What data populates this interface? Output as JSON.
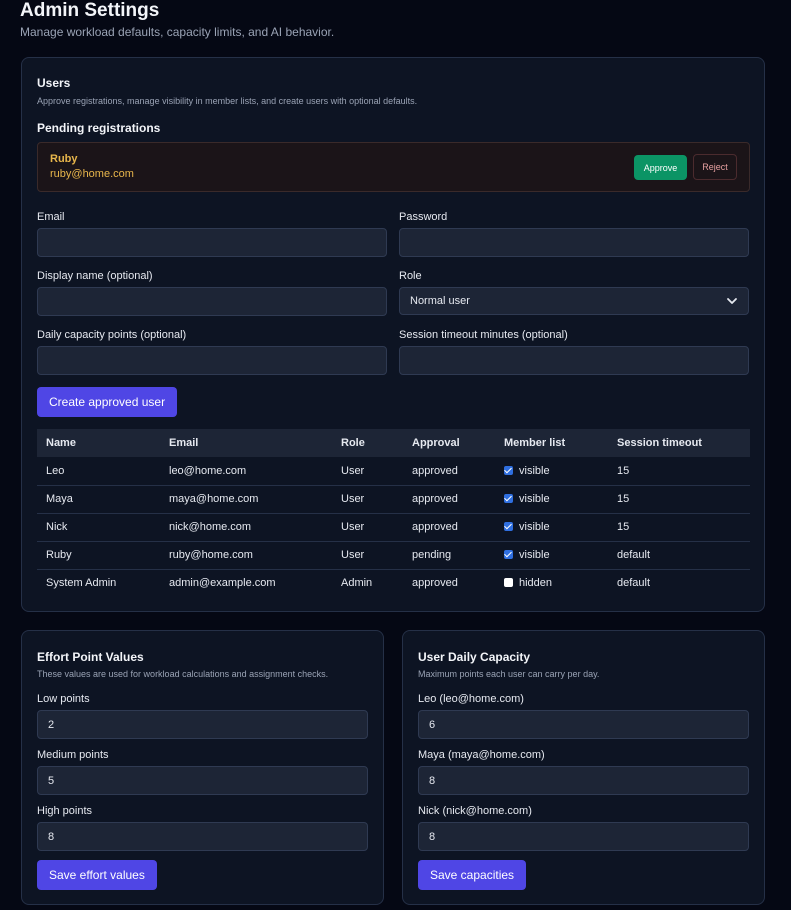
{
  "header": {
    "title": "Admin Settings",
    "subtitle": "Manage workload defaults, capacity limits, and AI behavior."
  },
  "users_card": {
    "title": "Users",
    "description": "Approve registrations, manage visibility in member lists, and create users with optional defaults.",
    "pending_title": "Pending registrations",
    "pending": {
      "name": "Ruby",
      "email": "ruby@home.com",
      "approve_label": "Approve",
      "reject_label": "Reject"
    },
    "form": {
      "email_label": "Email",
      "email_value": "",
      "password_label": "Password",
      "password_value": "",
      "display_name_label": "Display name (optional)",
      "display_name_value": "",
      "role_label": "Role",
      "role_value": "Normal user",
      "daily_capacity_label": "Daily capacity points (optional)",
      "daily_capacity_value": "",
      "session_timeout_label": "Session timeout minutes (optional)",
      "session_timeout_value": "",
      "create_button": "Create approved user"
    },
    "table": {
      "headers": [
        "Name",
        "Email",
        "Role",
        "Approval",
        "Member list",
        "Session timeout"
      ],
      "rows": [
        {
          "name": "Leo",
          "email": "leo@home.com",
          "role": "User",
          "approval": "approved",
          "visible": true,
          "member_list": "visible",
          "timeout": "15"
        },
        {
          "name": "Maya",
          "email": "maya@home.com",
          "role": "User",
          "approval": "approved",
          "visible": true,
          "member_list": "visible",
          "timeout": "15"
        },
        {
          "name": "Nick",
          "email": "nick@home.com",
          "role": "User",
          "approval": "approved",
          "visible": true,
          "member_list": "visible",
          "timeout": "15"
        },
        {
          "name": "Ruby",
          "email": "ruby@home.com",
          "role": "User",
          "approval": "pending",
          "visible": true,
          "member_list": "visible",
          "timeout": "default"
        },
        {
          "name": "System Admin",
          "email": "admin@example.com",
          "role": "Admin",
          "approval": "approved",
          "visible": false,
          "member_list": "hidden",
          "timeout": "default"
        }
      ]
    }
  },
  "effort_card": {
    "title": "Effort Point Values",
    "description": "These values are used for workload calculations and assignment checks.",
    "low_label": "Low points",
    "low_value": "2",
    "medium_label": "Medium points",
    "medium_value": "5",
    "high_label": "High points",
    "high_value": "8",
    "save_button": "Save effort values"
  },
  "capacity_card": {
    "title": "User Daily Capacity",
    "description": "Maximum points each user can carry per day.",
    "users": [
      {
        "label": "Leo (leo@home.com)",
        "value": "6"
      },
      {
        "label": "Maya (maya@home.com)",
        "value": "8"
      },
      {
        "label": "Nick (nick@home.com)",
        "value": "8"
      }
    ],
    "save_button": "Save capacities"
  },
  "colors": {
    "background": "#050814",
    "card": "#0d1423",
    "accent": "#4f46e5",
    "approve": "#0b9465",
    "pending_text": "#e8b64b"
  }
}
